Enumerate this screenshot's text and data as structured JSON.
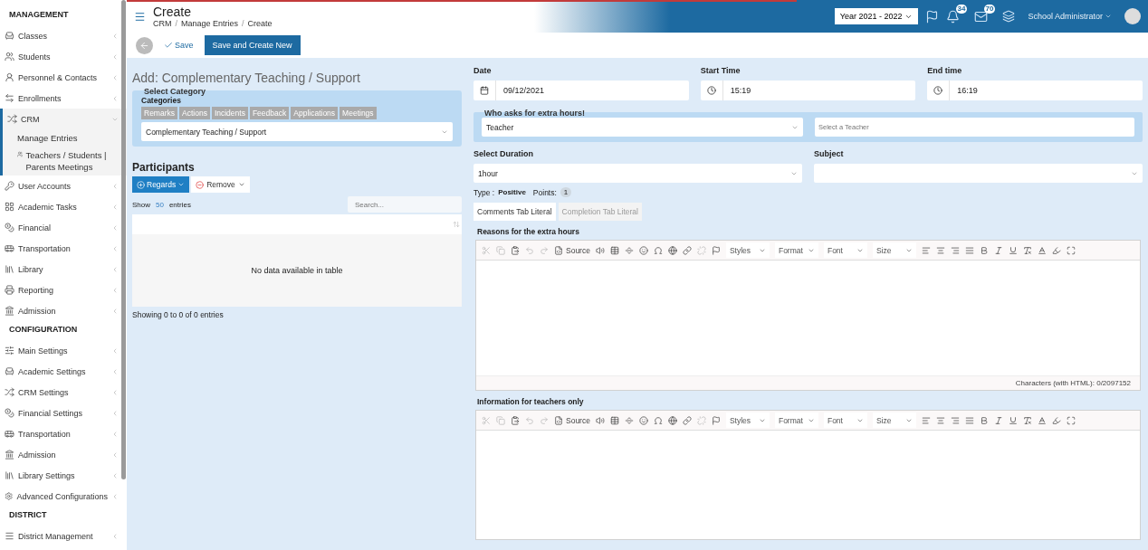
{
  "sidebar": {
    "sections": [
      {
        "title": "MANAGEMENT",
        "items": [
          {
            "label": "Classes",
            "selected": false,
            "expanded": false
          },
          {
            "label": "Students",
            "selected": false,
            "expanded": false
          },
          {
            "label": "Personnel & Contacts",
            "selected": false,
            "expanded": false
          },
          {
            "label": "Enrollments",
            "selected": false,
            "expanded": false
          },
          {
            "label": "CRM",
            "selected": true,
            "expanded": true,
            "children": [
              {
                "label": "Manage Entries"
              },
              {
                "label": "Teachers / Students | Parents Meetings"
              }
            ]
          },
          {
            "label": "User Accounts",
            "selected": false,
            "expanded": false
          },
          {
            "label": "Academic Tasks",
            "selected": false,
            "expanded": false
          },
          {
            "label": "Financial",
            "selected": false,
            "expanded": false
          },
          {
            "label": "Transportation",
            "selected": false,
            "expanded": false
          },
          {
            "label": "Library",
            "selected": false,
            "expanded": false
          },
          {
            "label": "Reporting",
            "selected": false,
            "expanded": false
          },
          {
            "label": "Admission",
            "selected": false,
            "expanded": false
          }
        ]
      },
      {
        "title": "CONFIGURATION",
        "items": [
          {
            "label": "Main Settings",
            "selected": false,
            "expanded": false
          },
          {
            "label": "Academic Settings",
            "selected": false,
            "expanded": false
          },
          {
            "label": "CRM Settings",
            "selected": false,
            "expanded": false
          },
          {
            "label": "Financial Settings",
            "selected": false,
            "expanded": false
          },
          {
            "label": "Transportation",
            "selected": false,
            "expanded": false
          },
          {
            "label": "Admission",
            "selected": false,
            "expanded": false
          },
          {
            "label": "Library Settings",
            "selected": false,
            "expanded": false
          },
          {
            "label": "Advanced Configurations",
            "selected": false,
            "expanded": false
          }
        ]
      },
      {
        "title": "DISTRICT",
        "items": [
          {
            "label": "District Management",
            "selected": false,
            "expanded": false
          }
        ]
      }
    ]
  },
  "header": {
    "title": "Create",
    "breadcrumbs": [
      "CRM",
      "Manage Entries",
      "Create"
    ],
    "breadcrumb_separator": "/",
    "year": "Year 2021 - 2022",
    "notifications": "34",
    "messages": "70",
    "user": "School Administrator"
  },
  "toolbar": {
    "save": "Save",
    "save_new": "Save and Create New"
  },
  "form": {
    "heading": "Add: Complementary Teaching / Support",
    "category": {
      "legend": "Select Category",
      "label": "Categories",
      "tabs": [
        {
          "label": "Remarks",
          "selected": false
        },
        {
          "label": "Actions",
          "selected": false
        },
        {
          "label": "Incidents",
          "selected": false
        },
        {
          "label": "Feedback",
          "selected": false
        },
        {
          "label": "Applications",
          "selected": false
        },
        {
          "label": "Meetings",
          "selected": false
        }
      ],
      "value": "Complementary Teaching / Support"
    },
    "participants": {
      "title": "Participants",
      "add": "Regards",
      "remove": "Remove",
      "show": "Show",
      "page_size": "50",
      "entries": "entries",
      "search_placeholder": "Search...",
      "empty": "No data available in table",
      "info": "Showing 0 to 0 of 0 entries"
    },
    "fields": [
      {
        "kind": "date",
        "label": "Date",
        "value": "09/12/2021"
      },
      {
        "kind": "time",
        "label": "Start Time",
        "value": "15:19"
      },
      {
        "kind": "time",
        "label": "End time",
        "value": "16:19"
      }
    ],
    "requester": {
      "legend": "Who asks for extra hours!",
      "value": "Teacher",
      "placeholder": "Select a Teacher"
    },
    "duration": {
      "label": "Select Duration",
      "value": "1hour"
    },
    "subject": {
      "label": "Subject"
    },
    "type_label": "Type :",
    "type_value": "Positive",
    "points_label": "Points:",
    "points": "1",
    "tabs": [
      {
        "label": "Comments Tab Literal",
        "selected": true
      },
      {
        "label": "Completion Tab Literal",
        "selected": false
      }
    ],
    "editors": [
      {
        "label": "Reasons for the extra hours",
        "source": "Source",
        "dropdowns": [
          "Styles",
          "Format",
          "Font",
          "Size"
        ],
        "footer": "Characters (with HTML): 0/2097152"
      },
      {
        "label": "Information for teachers only",
        "source": "Source",
        "dropdowns": [
          "Styles",
          "Format",
          "Font",
          "Size"
        ]
      }
    ]
  }
}
